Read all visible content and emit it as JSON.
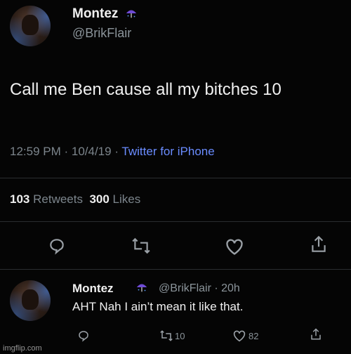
{
  "tweet": {
    "name": "Montez",
    "handle": "@BrikFlair",
    "text": "Call me Ben cause all my bitches 10",
    "time": "12:59 PM",
    "sep1": " · ",
    "date": "10/4/19",
    "sep2": " · ",
    "source": "Twitter for iPhone",
    "retweets_count": "103",
    "retweets_label": "Retweets",
    "likes_count": "300",
    "likes_label": "Likes",
    "icons": [
      "reply-icon",
      "retweet-icon",
      "like-icon",
      "share-icon",
      "umbrella-emoji-icon"
    ]
  },
  "reply": {
    "name": "Montez",
    "handle_time": "@BrikFlair · 20h",
    "text": "AHT Nah I ain’t mean it like that.",
    "retweets": "10",
    "likes": "82"
  },
  "watermark": "imgflip.com"
}
